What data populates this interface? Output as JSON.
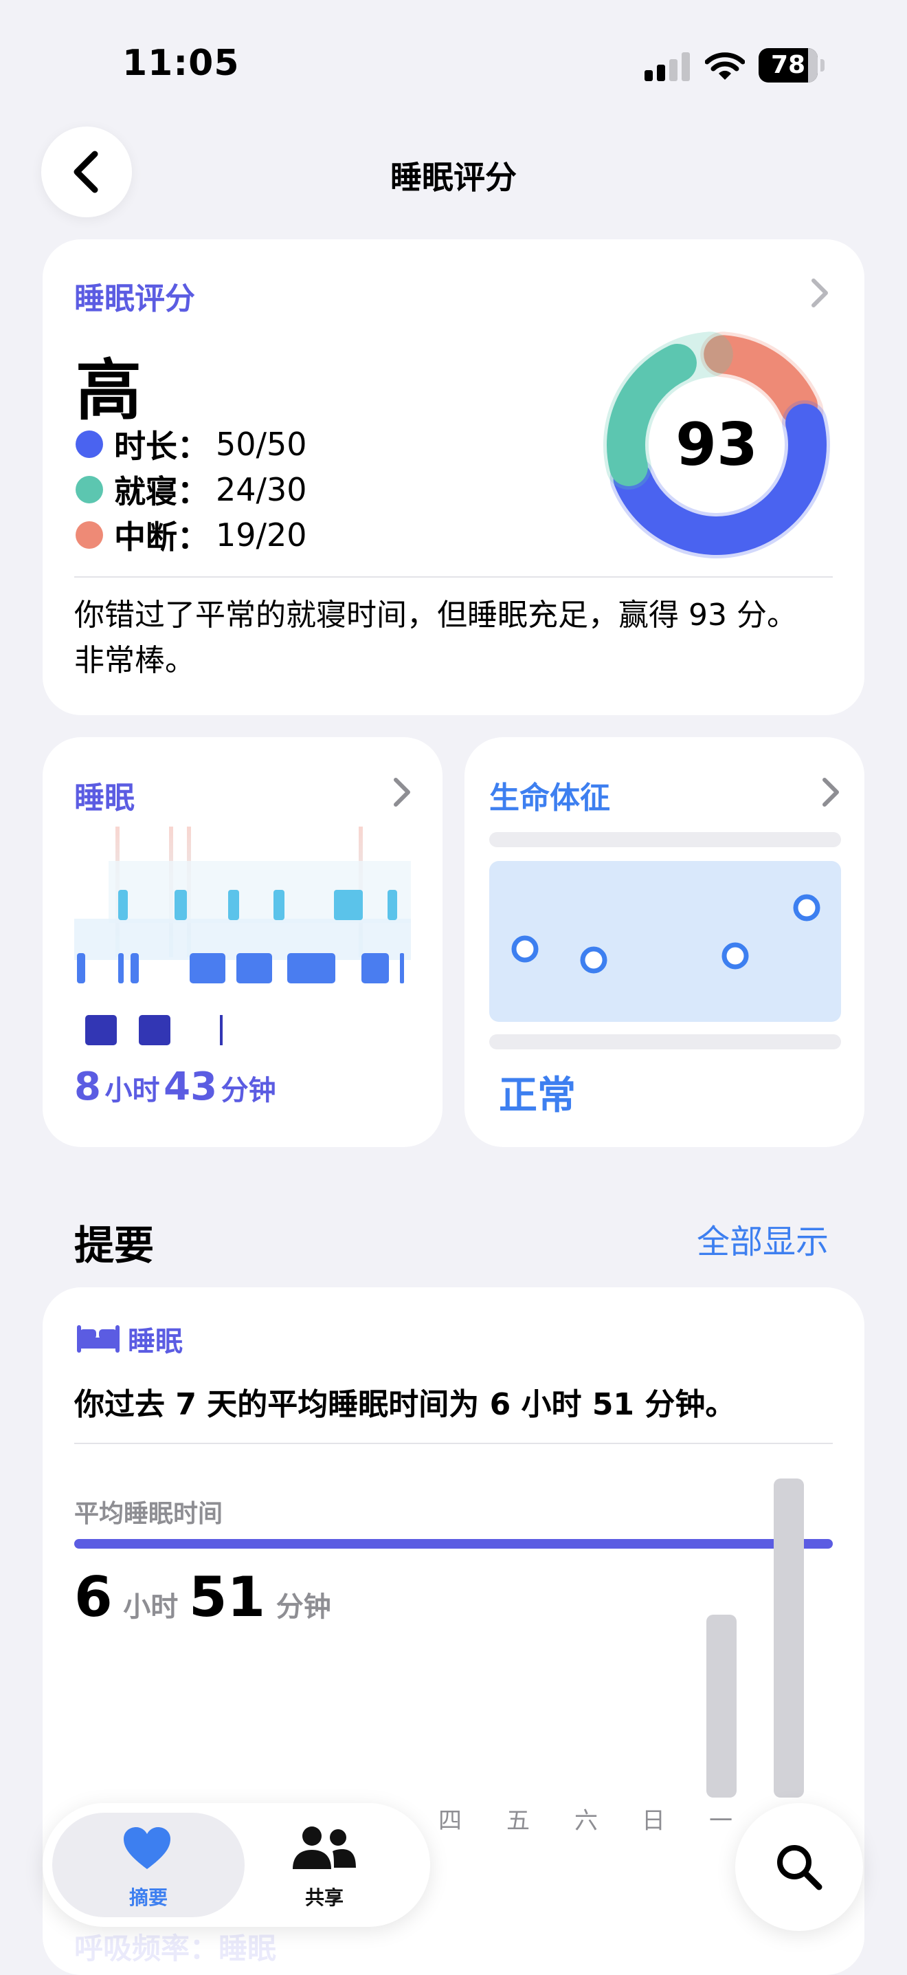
{
  "status_bar": {
    "time": "11:05",
    "battery": "78"
  },
  "header": {
    "title": "睡眠评分"
  },
  "score_card": {
    "label": "睡眠评分",
    "rating": "高",
    "score": "93",
    "components": [
      {
        "name": "时长：",
        "value": "50/50",
        "color": "#4a63f0",
        "earned": 50,
        "max": 50
      },
      {
        "name": "就寝：",
        "value": "24/30",
        "color": "#5cc6b0",
        "earned": 24,
        "max": 30
      },
      {
        "name": "中断：",
        "value": "19/20",
        "color": "#ee8a76",
        "earned": 19,
        "max": 20
      }
    ],
    "description": "你错过了平常的就寝时间，但睡眠充足，赢得 93 分。非常棒。"
  },
  "sleep_card": {
    "label": "睡眠",
    "hours": "8",
    "hours_unit": "小时",
    "minutes": "43",
    "minutes_unit": "分钟"
  },
  "vitals_card": {
    "label": "生命体征",
    "status": "正常"
  },
  "highlights": {
    "title": "提要",
    "show_all": "全部显示",
    "card": {
      "category": "睡眠",
      "text": "你过去 7 天的平均睡眠时间为 6 小时 51 分钟。",
      "avg_label": "平均睡眠时间",
      "avg_hours": "6",
      "avg_hours_unit": "小时",
      "avg_minutes": "51",
      "avg_minutes_unit": "分钟",
      "days": [
        "四",
        "五",
        "六",
        "日",
        "一"
      ]
    }
  },
  "tab_bar": {
    "tabs": [
      {
        "label": "摘要"
      },
      {
        "label": "共享"
      }
    ]
  },
  "faded_next": "呼吸频率：睡眠",
  "colors": {
    "accent_purple": "#5b5ce2",
    "accent_blue": "#3d7ff0"
  }
}
